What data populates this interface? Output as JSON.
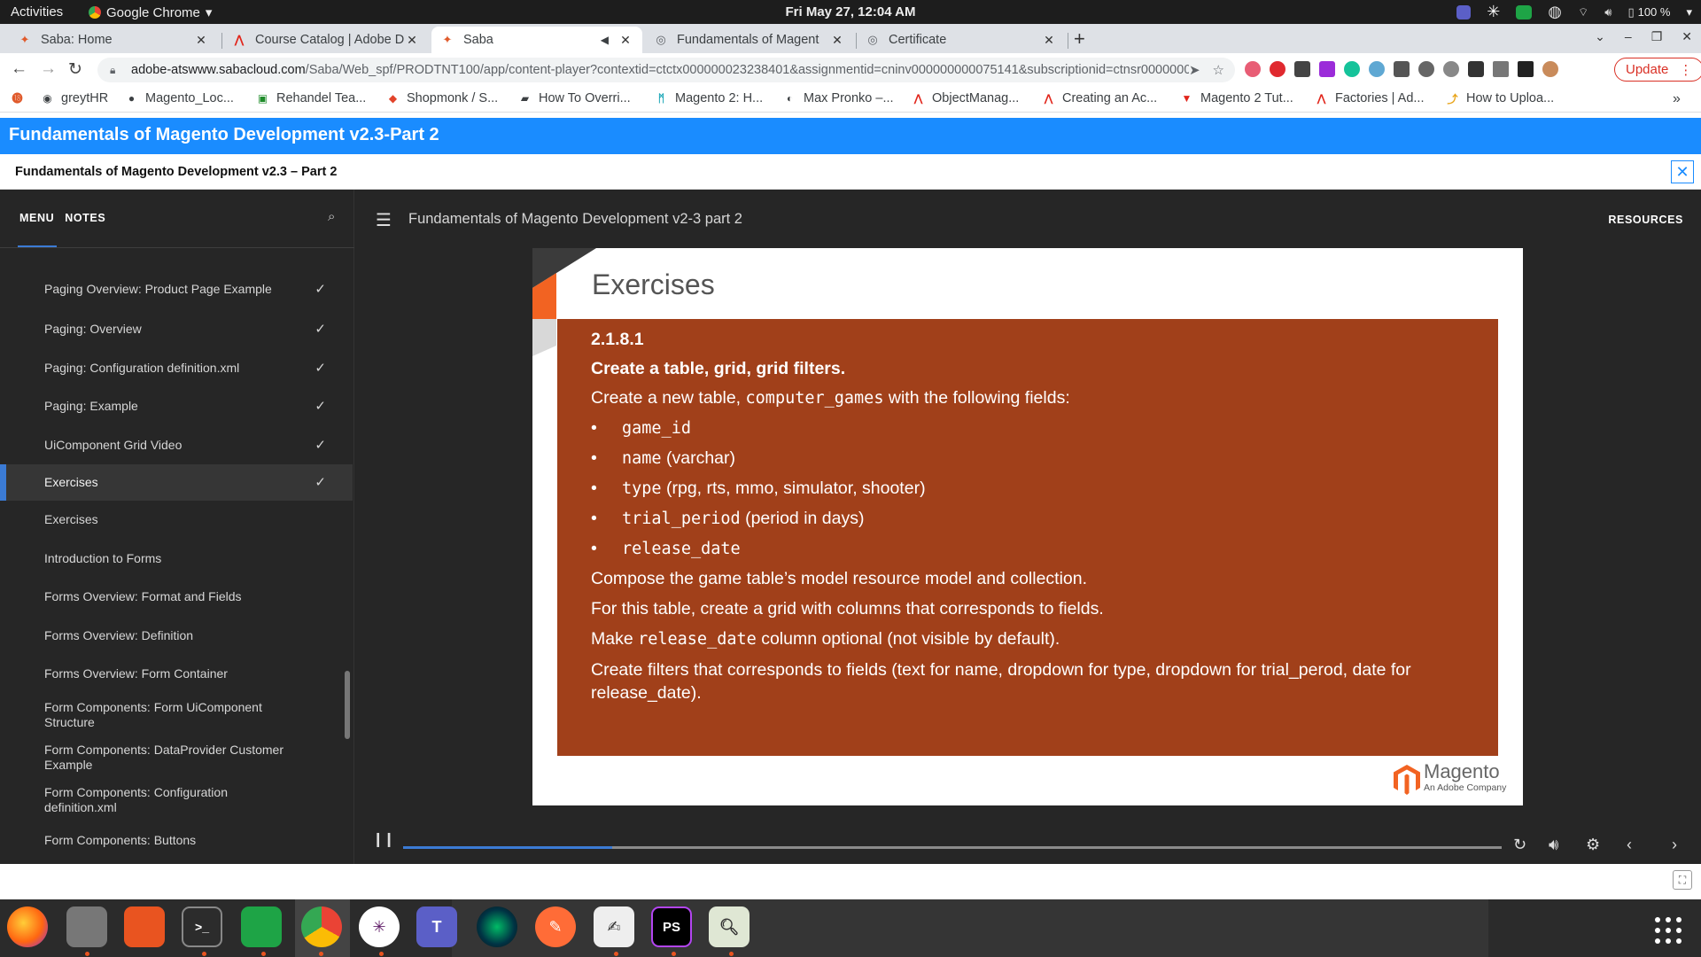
{
  "os_topbar": {
    "activities": "Activities",
    "app_name": "Google Chrome",
    "clock": "Fri May 27, 12:04 AM",
    "battery": "100 %"
  },
  "browser": {
    "tabs": [
      {
        "title": "Saba: Home",
        "icon": "saba-icon",
        "active": false
      },
      {
        "title": "Course Catalog | Adobe D",
        "icon": "adobe-icon",
        "active": false
      },
      {
        "title": "Saba",
        "icon": "saba-icon",
        "active": true
      },
      {
        "title": "Fundamentals of Magent",
        "icon": "globe-icon",
        "active": false
      },
      {
        "title": "Certificate",
        "icon": "globe-icon",
        "active": false
      }
    ],
    "url_host": "adobe-atswww.sabacloud.com",
    "url_path": "/Saba/Web_spf/PRODTNT100/app/content-player?contextid=ctctx000000023238401&assignmentid=cninv000000000075141&subscriptionid=ctnsr0000000...",
    "update_label": "Update",
    "bookmarks": [
      {
        "label": "greytHR",
        "icon": "greythr-icon"
      },
      {
        "label": "Magento_Loc...",
        "icon": "github-icon"
      },
      {
        "label": "Rehandel Tea...",
        "icon": "trello-icon"
      },
      {
        "label": "Shopmonk / S...",
        "icon": "gitlab-icon"
      },
      {
        "label": "How To Overri...",
        "icon": "bookmark-icon"
      },
      {
        "label": "Magento 2: H...",
        "icon": "magento-m-icon"
      },
      {
        "label": "Max Pronko –...",
        "icon": "mp-icon"
      },
      {
        "label": "ObjectManag...",
        "icon": "adobe-icon"
      },
      {
        "label": "Creating an Ac...",
        "icon": "adobe-icon"
      },
      {
        "label": "Magento 2 Tut...",
        "icon": "magento-red-icon"
      },
      {
        "label": "Factories | Ad...",
        "icon": "adobe-icon"
      },
      {
        "label": "How to Uploa...",
        "icon": "upload-icon"
      }
    ],
    "bookmarks_more": "»"
  },
  "page": {
    "course_title": "Fundamentals of Magento Development v2.3-Part 2",
    "course_subtitle": "Fundamentals of Magento Development v2.3 – Part 2",
    "close_label": "✕"
  },
  "sidebar": {
    "tab_menu": "MENU",
    "tab_notes": "NOTES",
    "items": [
      {
        "label": "Paging Overview: Product Page Example",
        "completed": true,
        "selected": false
      },
      {
        "label": "Paging: Overview",
        "completed": true,
        "selected": false
      },
      {
        "label": "Paging: Configuration definition.xml",
        "completed": true,
        "selected": false
      },
      {
        "label": "Paging: Example",
        "completed": true,
        "selected": false
      },
      {
        "label": "UiComponent Grid Video",
        "completed": true,
        "selected": false
      },
      {
        "label": "Exercises",
        "completed": true,
        "selected": true
      },
      {
        "label": "Exercises",
        "completed": false,
        "selected": false
      },
      {
        "label": "Introduction to Forms",
        "completed": false,
        "selected": false
      },
      {
        "label": "Forms Overview: Format and Fields",
        "completed": false,
        "selected": false
      },
      {
        "label": "Forms Overview: Definition",
        "completed": false,
        "selected": false
      },
      {
        "label": "Forms Overview: Form Container",
        "completed": false,
        "selected": false
      },
      {
        "label": "Form Components: Form UiComponent Structure",
        "completed": false,
        "selected": false
      },
      {
        "label": "Form Components: DataProvider Customer Example",
        "completed": false,
        "selected": false
      },
      {
        "label": "Form Components: Configuration definition.xml",
        "completed": false,
        "selected": false
      },
      {
        "label": "Form Components: Buttons",
        "completed": false,
        "selected": false
      }
    ]
  },
  "player": {
    "topic_title": "Fundamentals of Magento Development v2-3 part 2",
    "resources_label": "RESOURCES",
    "progress": 0.19
  },
  "slide": {
    "heading": "Exercises",
    "exercise_number": "2.1.8.1",
    "exercise_title": "Create a table, grid, grid filters.",
    "intro_before": "Create a new table,",
    "intro_code": "computer_games",
    "intro_after": "with the following fields:",
    "fields": [
      {
        "code": "game_id",
        "desc": ""
      },
      {
        "code": "name",
        "desc": "(varchar)"
      },
      {
        "code": "type",
        "desc": "(rpg, rts, mmo, simulator, shooter)"
      },
      {
        "code": "trial_period",
        "desc": "(period in days)"
      },
      {
        "code": "release_date",
        "desc": ""
      }
    ],
    "line_compose": "Compose the game table’s model resource model and collection.",
    "line_grid": "For this table, create a grid with columns that corresponds to fields.",
    "line_optional_before": "Make",
    "line_optional_code": "release_date",
    "line_optional_after": "column optional (not visible by default).",
    "line_filters": "Create filters that corresponds to fields (text for name, dropdown for type, dropdown for trial_perod, date for release_date).",
    "logo_word": "Magento",
    "logo_sub": "An Adobe Company"
  },
  "colors": {
    "header_blue": "#1a8cff",
    "player_bg": "#262626",
    "slide_box": "#a1401a",
    "accent": "#3b7bd5",
    "magento_orange": "#f26322"
  }
}
